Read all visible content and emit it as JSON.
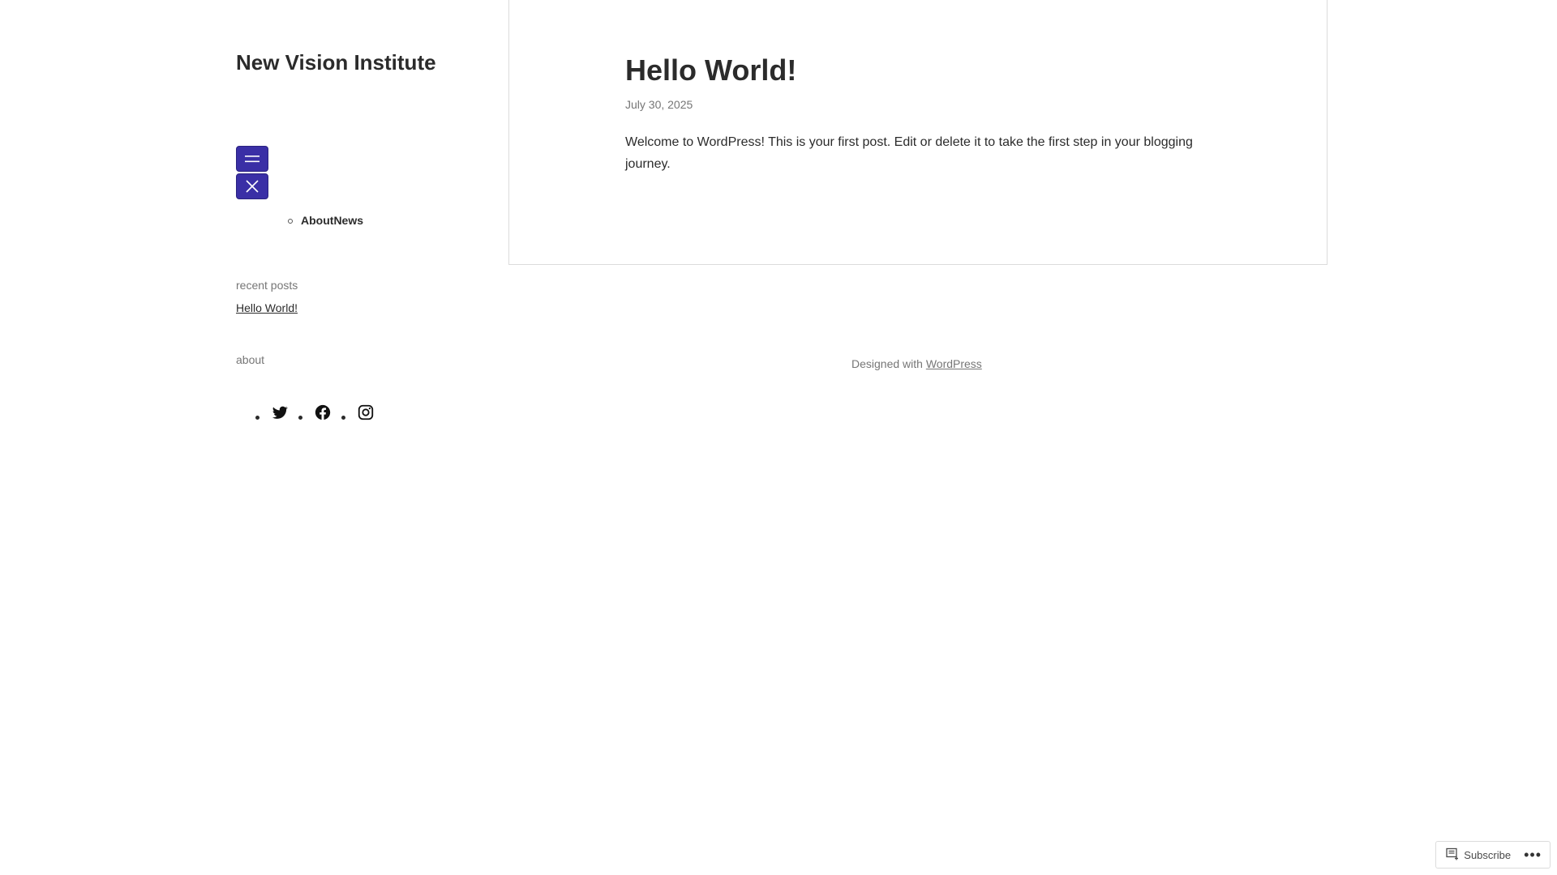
{
  "site": {
    "title": "New Vision Institute"
  },
  "nav": {
    "open_icon": "hamburger-icon",
    "close_icon": "close-icon",
    "items": [
      {
        "label": "About"
      },
      {
        "label": "News"
      }
    ]
  },
  "sidebar": {
    "recent_posts_title": "recent posts",
    "recent_posts": [
      {
        "label": "Hello World!"
      }
    ],
    "about_title": "about",
    "social": [
      {
        "icon": "twitter-icon"
      },
      {
        "icon": "facebook-icon"
      },
      {
        "icon": "instagram-icon"
      }
    ]
  },
  "post": {
    "title": "Hello World!",
    "date": "July 30, 2025",
    "body": "Welcome to WordPress! This is your first post. Edit or delete it to take the first step in your blogging journey."
  },
  "footer": {
    "prefix": "Designed with",
    "link_label": "WordPress"
  },
  "subscribe": {
    "label": "Subscribe",
    "more_label": "•••"
  },
  "colors": {
    "accent": "#3a2fa6",
    "text": "#2b2b2b",
    "muted": "#767676"
  }
}
